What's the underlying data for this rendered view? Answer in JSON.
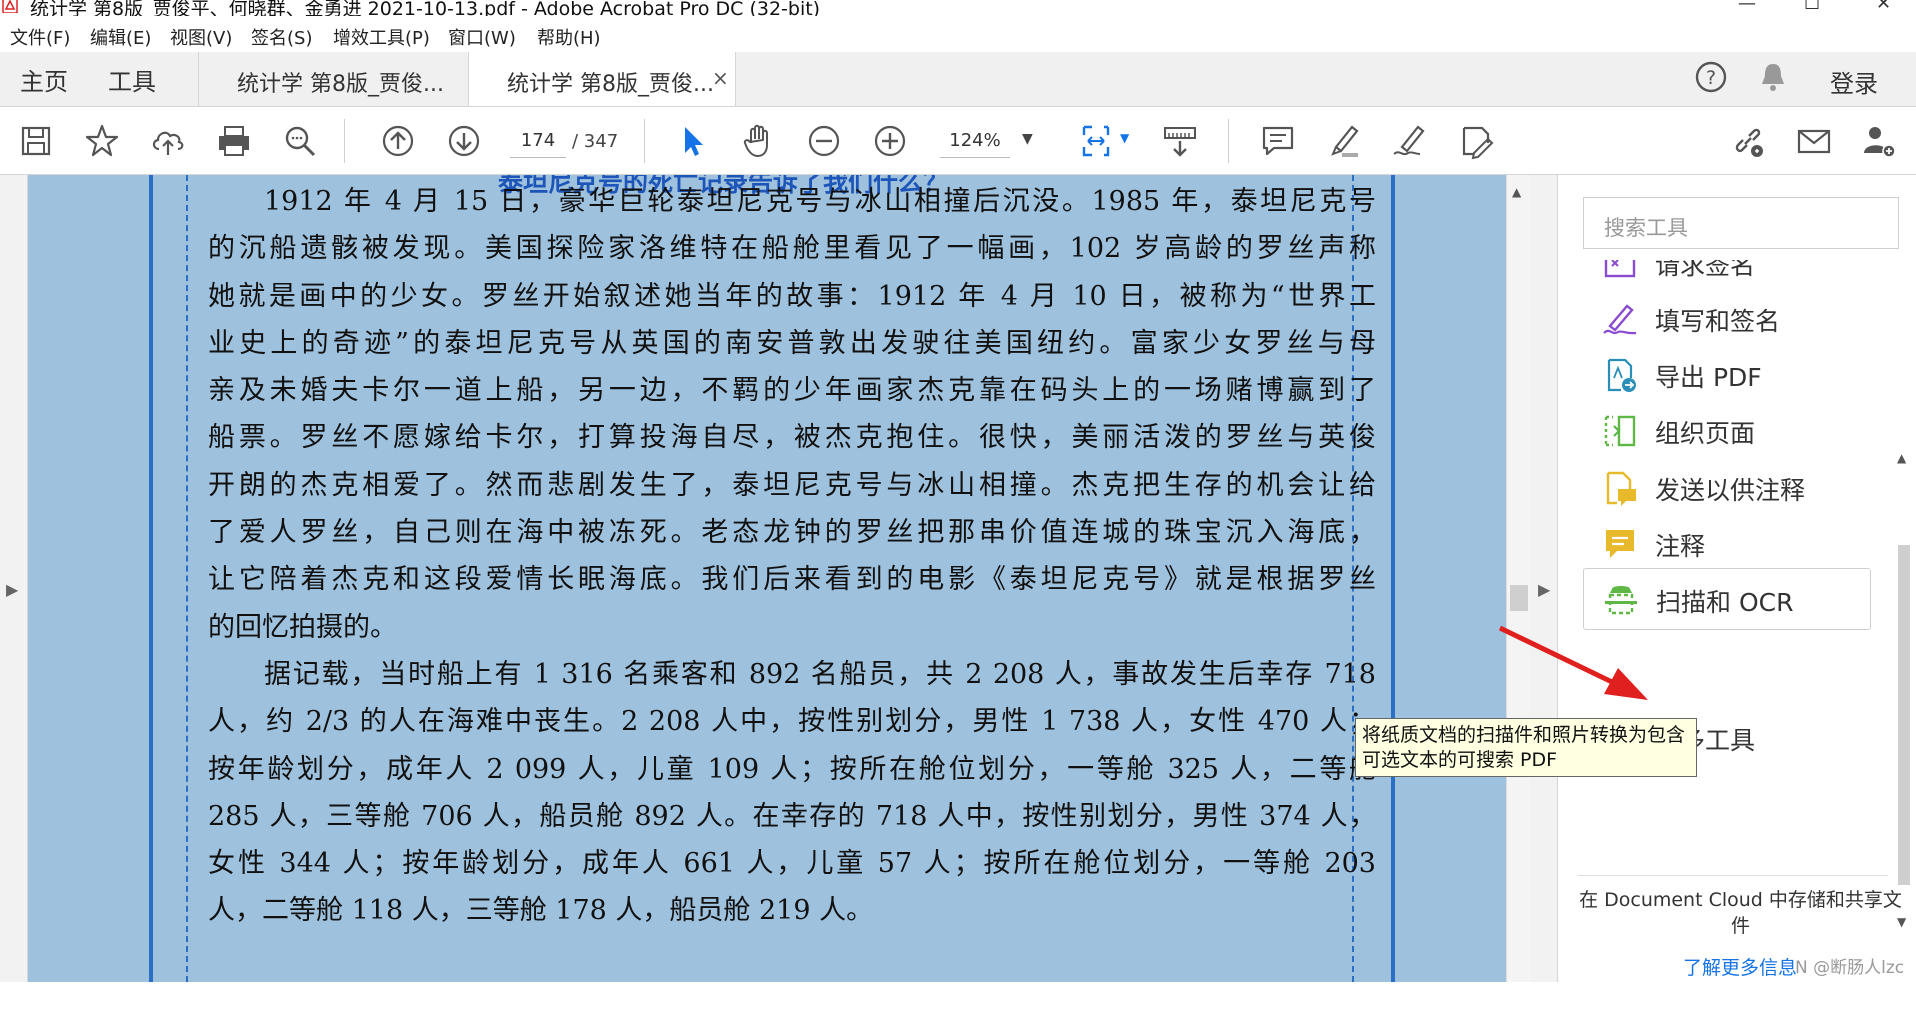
{
  "window": {
    "title": "统计学 第8版_贾俊平、何晓群、金勇进 2021-10-13.pdf - Adobe Acrobat Pro DC (32-bit)",
    "controls": [
      "—",
      "☐",
      "✕"
    ]
  },
  "menu": [
    "文件(F)",
    "编辑(E)",
    "视图(V)",
    "签名(S)",
    "增效工具(P)",
    "窗口(W)",
    "帮助(H)"
  ],
  "tabs": {
    "home": "主页",
    "tools": "工具",
    "docs": [
      {
        "label": "统计学 第8版_贾俊..."
      },
      {
        "label": "统计学 第8版_贾俊...",
        "close": "×"
      }
    ],
    "help_icon": "?",
    "login": "登录"
  },
  "toolbar": {
    "page_current": "174",
    "page_total": "/ 347",
    "zoom": "124%",
    "zoom_dropdown": "▼"
  },
  "document": {
    "heading": "泰坦尼克号的死亡记录告诉了我们什么？",
    "lines": [
      "1912 年 4 月 15 日，豪华巨轮泰坦尼克号与冰山相撞后沉没。1985 年，泰坦尼克号",
      "的沉船遗骸被发现。美国探险家洛维特在船舱里看见了一幅画，102 岁高龄的罗丝声称",
      "她就是画中的少女。罗丝开始叙述她当年的故事：1912 年 4 月 10 日，被称为“世界工",
      "业史上的奇迹”的泰坦尼克号从英国的南安普敦出发驶往美国纽约。富家少女罗丝与母",
      "亲及未婚夫卡尔一道上船，另一边，不羁的少年画家杰克靠在码头上的一场赌博赢到了",
      "船票。罗丝不愿嫁给卡尔，打算投海自尽，被杰克抱住。很快，美丽活泼的罗丝与英俊",
      "开朗的杰克相爱了。然而悲剧发生了，泰坦尼克号与冰山相撞。杰克把生存的机会让给",
      "了爱人罗丝，自己则在海中被冻死。老态龙钟的罗丝把那串价值连城的珠宝沉入海底，",
      "让它陪着杰克和这段爱情长眠海底。我们后来看到的电影《泰坦尼克号》就是根据罗丝",
      "的回忆拍摄的。",
      "据记载，当时船上有 1 316 名乘客和 892 名船员，共 2 208 人，事故发生后幸存 718",
      "人，约 2/3 的人在海难中丧生。2 208 人中，按性别划分，男性 1 738 人，女性 470 人；",
      "按年龄划分，成年人 2 099 人，儿童 109 人；按所在舱位划分，一等舱 325 人，二等舱",
      "285 人，三等舱 706 人，船员舱 892 人。在幸存的 718 人中，按性别划分，男性 374 人，",
      "女性 344 人；按年龄划分，成年人 661 人，儿童 57 人；按所在舱位划分，一等舱 203",
      "人，二等舱 118 人，三等舱 178 人，船员舱 219 人。"
    ]
  },
  "right_panel": {
    "search_placeholder": "搜索工具",
    "tools": [
      {
        "label": "请求签名",
        "icon": "request-signature-icon"
      },
      {
        "label": "填写和签名",
        "icon": "fill-sign-icon"
      },
      {
        "label": "导出 PDF",
        "icon": "export-pdf-icon"
      },
      {
        "label": "组织页面",
        "icon": "organize-pages-icon"
      },
      {
        "label": "发送以供注释",
        "icon": "send-for-comments-icon"
      },
      {
        "label": "注释",
        "icon": "comment-icon"
      },
      {
        "label": "扫描和 OCR",
        "icon": "scan-ocr-icon"
      },
      {
        "label": "更多工具",
        "icon": "more-tools-icon"
      }
    ],
    "cloud_text": "在 Document Cloud 中存储和共享文件",
    "learn_more": "了解更多信息",
    "watermark": "N @断肠人lzc"
  },
  "tooltip": {
    "line1": "将纸质文档的扫描件和照片转换为包含",
    "line2": "可选文本的可搜索 PDF"
  },
  "colors": {
    "page_bg": "#9ec1dd",
    "border_blue": "#2a6fc4",
    "heading_blue": "#1d55b8",
    "link_blue": "#1473e6",
    "tool_purple": "#8a4bd0",
    "tool_green": "#5fb846",
    "tool_yellow": "#e8b92a",
    "annotation_red": "#e0201e"
  }
}
